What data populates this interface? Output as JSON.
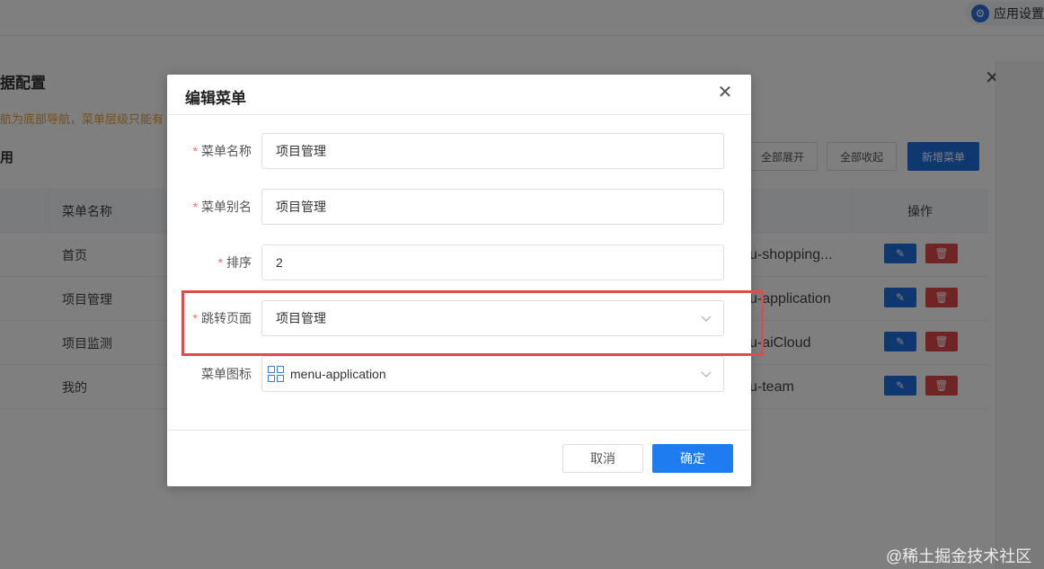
{
  "topbar": {
    "app_settings_label": "应用设置",
    "app_settings_icon": "gear-icon"
  },
  "background": {
    "title": "据配置",
    "hint": "航为底部导航，菜单层级只能有",
    "subtitle": "用",
    "buttons": {
      "expand_all": "全部展开",
      "collapse_all": "全部收起",
      "add_menu": "新增菜单"
    },
    "table": {
      "headers": {
        "menu_name": "菜单名称",
        "actions": "操作"
      },
      "rows": [
        {
          "menu_name": "首页",
          "icon": "u-shopping..."
        },
        {
          "menu_name": "项目管理",
          "icon": "u-application"
        },
        {
          "menu_name": "项目监测",
          "icon": "u-aiCloud"
        },
        {
          "menu_name": "我的",
          "icon": "u-team"
        }
      ]
    }
  },
  "dialog": {
    "title": "编辑菜单",
    "fields": {
      "menu_name": {
        "label": "菜单名称",
        "required": true,
        "value": "项目管理"
      },
      "menu_alias": {
        "label": "菜单别名",
        "required": true,
        "value": "项目管理"
      },
      "sort": {
        "label": "排序",
        "required": true,
        "value": "2"
      },
      "jump_page": {
        "label": "跳转页面",
        "required": true,
        "value": "项目管理"
      },
      "menu_icon": {
        "label": "菜单图标",
        "required": false,
        "value": "menu-application",
        "icon": "grid-icon"
      }
    },
    "footer": {
      "cancel_label": "取消",
      "confirm_label": "确定"
    }
  },
  "colors": {
    "primary": "#1f7bf0",
    "danger": "#e04848",
    "required_mark": "#f56c6c",
    "highlight": "#e04b4b"
  },
  "watermark": "@稀土掘金技术社区"
}
